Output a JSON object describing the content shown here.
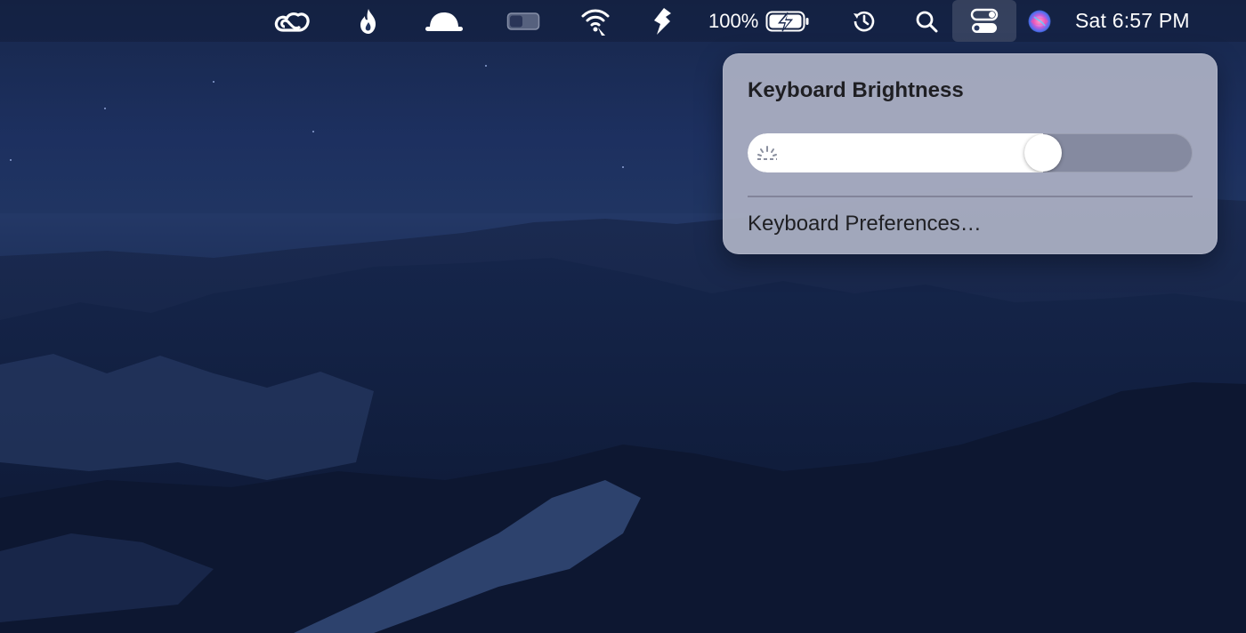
{
  "menubar": {
    "status_items": [
      {
        "icon": "creative-cloud-icon"
      },
      {
        "icon": "flame-icon"
      },
      {
        "icon": "dome-hat-icon"
      },
      {
        "icon": "toggle-switch-icon"
      },
      {
        "icon": "wifi-icon"
      },
      {
        "icon": "dropzone-icon"
      }
    ],
    "battery": {
      "percent_label": "100%",
      "percent": 100,
      "charging": true
    },
    "time_machine_icon": "clock-arrow-icon",
    "search_icon": "magnifying-glass-icon",
    "control_center_icon": "control-center-icon",
    "siri_icon": "siri-icon",
    "clock": "Sat 6:57 PM"
  },
  "panel": {
    "title": "Keyboard Brightness",
    "brightness_level": 0.68,
    "slider_icon": "keyboard-brightness-low-icon",
    "link_label": "Keyboard Preferences…"
  },
  "colors": {
    "panel_bg": "#acb0c4",
    "slider_track": "#6e7288",
    "slider_fill": "#ffffff",
    "menubar_text": "#ffffff"
  }
}
